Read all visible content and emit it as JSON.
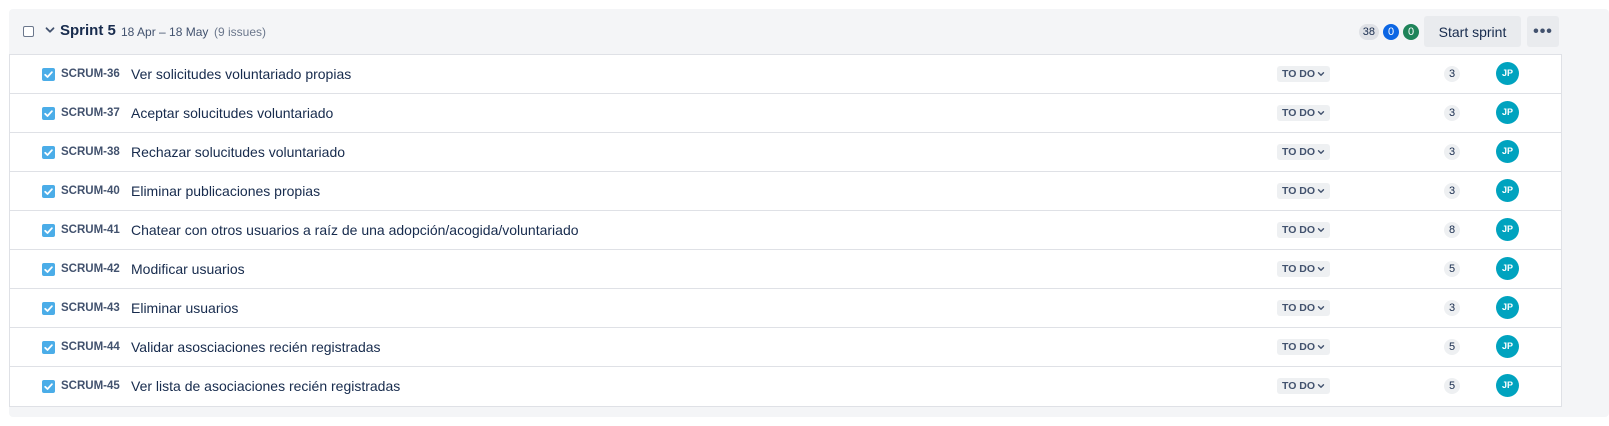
{
  "sprint": {
    "name": "Sprint 5",
    "dates": "18 Apr – 18 May",
    "issue_count": "(9 issues)",
    "stats": {
      "total": "38",
      "in_progress": "0",
      "done": "0"
    },
    "start_button_label": "Start sprint",
    "more_label": "•••"
  },
  "colors": {
    "story_icon": "#4bade8",
    "avatar": "#00a3bf",
    "in_progress_pill": "#0c66e4",
    "done_pill": "#1f845a"
  },
  "issues": [
    {
      "key": "SCRUM-36",
      "summary": "Ver solicitudes voluntariado propias",
      "status": "TO DO",
      "points": "3",
      "assignee": "JP"
    },
    {
      "key": "SCRUM-37",
      "summary": "Aceptar solucitudes voluntariado",
      "status": "TO DO",
      "points": "3",
      "assignee": "JP"
    },
    {
      "key": "SCRUM-38",
      "summary": "Rechazar solucitudes voluntariado",
      "status": "TO DO",
      "points": "3",
      "assignee": "JP"
    },
    {
      "key": "SCRUM-40",
      "summary": "Eliminar publicaciones propias",
      "status": "TO DO",
      "points": "3",
      "assignee": "JP"
    },
    {
      "key": "SCRUM-41",
      "summary": "Chatear con otros usuarios a raíz de una adopción/acogida/voluntariado",
      "status": "TO DO",
      "points": "8",
      "assignee": "JP"
    },
    {
      "key": "SCRUM-42",
      "summary": "Modificar usuarios",
      "status": "TO DO",
      "points": "5",
      "assignee": "JP"
    },
    {
      "key": "SCRUM-43",
      "summary": "Eliminar usuarios",
      "status": "TO DO",
      "points": "3",
      "assignee": "JP"
    },
    {
      "key": "SCRUM-44",
      "summary": "Validar asosciaciones recién registradas",
      "status": "TO DO",
      "points": "5",
      "assignee": "JP"
    },
    {
      "key": "SCRUM-45",
      "summary": "Ver lista de asociaciones recién registradas",
      "status": "TO DO",
      "points": "5",
      "assignee": "JP"
    }
  ]
}
